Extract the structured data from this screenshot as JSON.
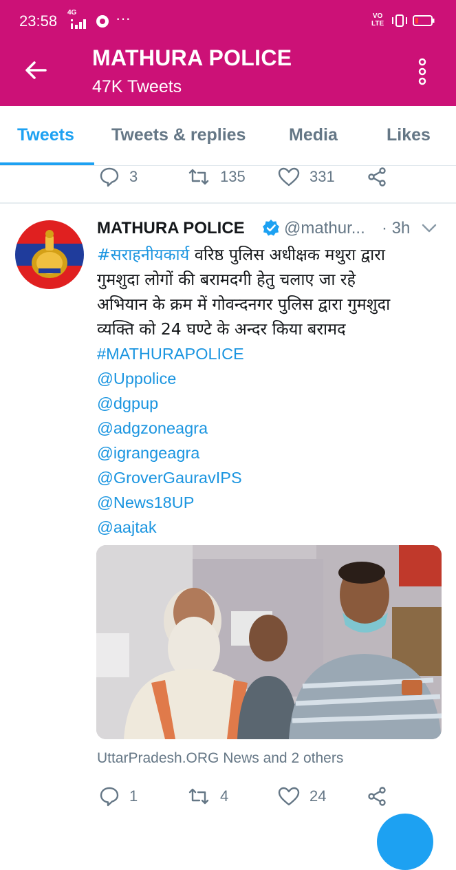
{
  "status_bar": {
    "time": "23:58",
    "network": "4G",
    "more": "···",
    "volte_1": "VO",
    "volte_2": "LTE"
  },
  "header": {
    "title": "MATHURA POLICE",
    "subtitle": "47K Tweets"
  },
  "tabs": [
    {
      "label": "Tweets",
      "active": true
    },
    {
      "label": "Tweets & replies",
      "active": false
    },
    {
      "label": "Media",
      "active": false
    },
    {
      "label": "Likes",
      "active": false
    }
  ],
  "prev_tweet_actions": {
    "replies": "3",
    "retweets": "135",
    "likes": "331"
  },
  "tweet": {
    "author_name": "MATHURA POLICE",
    "handle": "@mathur...",
    "separator": "·",
    "time": "3h",
    "hashtag_hindi": "#सराहनीयकार्य",
    "text_lines": [
      " वरिष्ठ पुलिस अधीक्षक मथुरा द्वारा",
      "गुमशुदा लोगों की बरामदगी हेतु चलाए जा रहे",
      "अभियान के क्रम में गोवन्दनगर पुलिस द्वारा गुमशुदा",
      "व्यक्ति को 24 घण्टे के अन्दर किया बरामद"
    ],
    "links": [
      "#MATHURAPOLICE",
      "@Uppolice",
      "@dgpup",
      "@adgzoneagra",
      "@igrangeagra",
      "@GroverGauravIPS",
      "@News18UP",
      "@aajtak"
    ],
    "media_caption": "UttarPradesh.ORG News and 2 others",
    "replies": "1",
    "retweets": "4",
    "likes": "24"
  },
  "colors": {
    "brand": "#cc1177",
    "accent": "#1da1f2",
    "muted": "#657786"
  }
}
